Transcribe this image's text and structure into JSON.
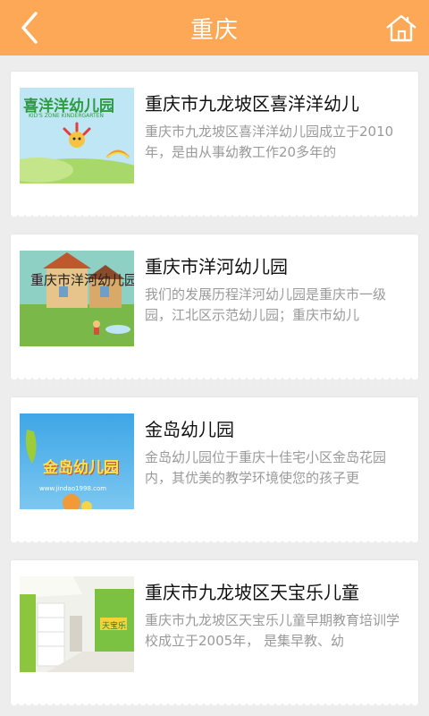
{
  "header": {
    "title": "重庆",
    "back_icon": "chevron-left-icon",
    "home_icon": "home-icon",
    "bg_color": "#fca857"
  },
  "items": [
    {
      "title": "重庆市九龙坡区喜洋洋幼儿",
      "desc": "重庆市九龙坡区喜洋洋幼儿园成立于2010年，是由从事幼教工作20多年的",
      "thumb_text": "喜洋洋幼儿园",
      "thumb_sub": "KID'S ZONE KINDERGARTEN"
    },
    {
      "title": "重庆市洋河幼儿园",
      "desc": "我们的发展历程洋河幼儿园是重庆市一级园，江北区示范幼儿园；重庆市幼儿",
      "thumb_text": "重庆市洋河幼儿园"
    },
    {
      "title": "金岛幼儿园",
      "desc": "金岛幼儿园位于重庆十佳宅小区金岛花园内，其优美的教学环境使您的孩子更",
      "thumb_text": "金岛幼儿园",
      "thumb_sub": "www.jindao1998.com"
    },
    {
      "title": "重庆市九龙坡区天宝乐儿童",
      "desc": "重庆市九龙坡区天宝乐儿童早期教育培训学校成立于2005年， 是集早教、幼",
      "thumb_text": "天宝乐"
    }
  ]
}
